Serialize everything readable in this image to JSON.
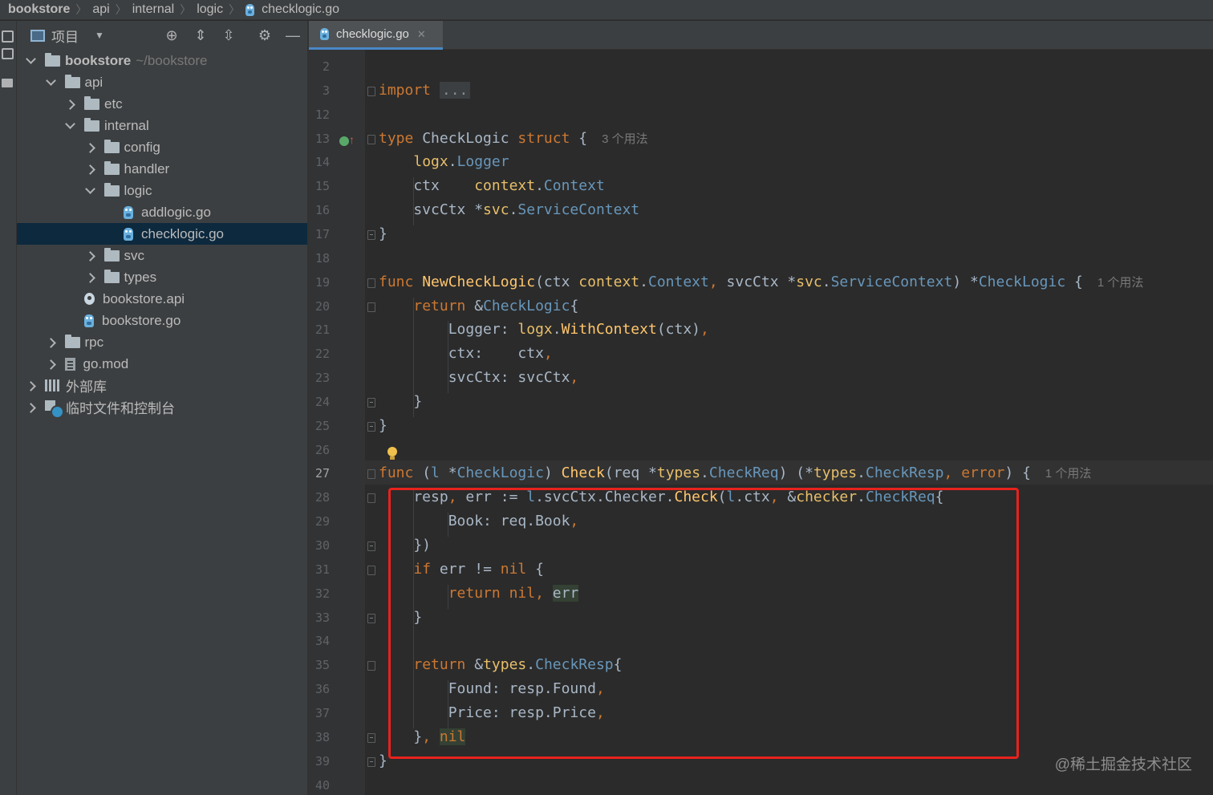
{
  "breadcrumb": [
    "bookstore",
    "api",
    "internal",
    "logic",
    "checklogic.go"
  ],
  "project_panel": {
    "title": "项目",
    "tree": [
      {
        "label": "bookstore",
        "hint": "~/bookstore",
        "depth": 0,
        "chevron": "down",
        "icon": "folder",
        "bold": true
      },
      {
        "label": "api",
        "depth": 1,
        "chevron": "down",
        "icon": "folder"
      },
      {
        "label": "etc",
        "depth": 2,
        "chevron": "right",
        "icon": "folder"
      },
      {
        "label": "internal",
        "depth": 2,
        "chevron": "down",
        "icon": "folder"
      },
      {
        "label": "config",
        "depth": 3,
        "chevron": "right",
        "icon": "folder"
      },
      {
        "label": "handler",
        "depth": 3,
        "chevron": "right",
        "icon": "folder"
      },
      {
        "label": "logic",
        "depth": 3,
        "chevron": "down",
        "icon": "folder"
      },
      {
        "label": "addlogic.go",
        "depth": 4,
        "chevron": "none",
        "icon": "gofile"
      },
      {
        "label": "checklogic.go",
        "depth": 4,
        "chevron": "none",
        "icon": "gofile",
        "selected": true
      },
      {
        "label": "svc",
        "depth": 3,
        "chevron": "right",
        "icon": "folder"
      },
      {
        "label": "types",
        "depth": 3,
        "chevron": "right",
        "icon": "folder"
      },
      {
        "label": "bookstore.api",
        "depth": 2,
        "chevron": "none",
        "icon": "api"
      },
      {
        "label": "bookstore.go",
        "depth": 2,
        "chevron": "none",
        "icon": "gofile"
      },
      {
        "label": "rpc",
        "depth": 1,
        "chevron": "right",
        "icon": "folder"
      },
      {
        "label": "go.mod",
        "depth": 1,
        "chevron": "right",
        "icon": "mod"
      },
      {
        "label": "外部库",
        "depth": 0,
        "chevron": "right",
        "icon": "lib"
      },
      {
        "label": "临时文件和控制台",
        "depth": 0,
        "chevron": "right",
        "icon": "scratch"
      }
    ]
  },
  "editor": {
    "tab_label": "checklogic.go",
    "current_line": "27",
    "lines": [
      {
        "n": "2",
        "tokens": []
      },
      {
        "n": "3",
        "fold": "open",
        "tokens": [
          {
            "t": "kw",
            "v": "import"
          },
          {
            "t": "id",
            "v": " "
          },
          {
            "t": "folded",
            "v": "..."
          }
        ]
      },
      {
        "n": "12",
        "tokens": []
      },
      {
        "n": "13",
        "fold": "open",
        "tokens": [
          {
            "t": "kw",
            "v": "type"
          },
          {
            "t": "id",
            "v": " CheckLogic "
          },
          {
            "t": "kw",
            "v": "struct"
          },
          {
            "t": "id",
            "v": " {"
          },
          {
            "t": "hint",
            "v": "3 个用法"
          }
        ]
      },
      {
        "n": "14",
        "tokens": [
          {
            "t": "id",
            "v": "    "
          },
          {
            "t": "pkg",
            "v": "logx"
          },
          {
            "t": "id",
            "v": "."
          },
          {
            "t": "ty",
            "v": "Logger"
          }
        ]
      },
      {
        "n": "15",
        "tokens": [
          {
            "t": "id",
            "v": "    ctx    "
          },
          {
            "t": "pkg",
            "v": "context"
          },
          {
            "t": "id",
            "v": "."
          },
          {
            "t": "ty",
            "v": "Context"
          }
        ]
      },
      {
        "n": "16",
        "tokens": [
          {
            "t": "id",
            "v": "    svcCtx *"
          },
          {
            "t": "pkg",
            "v": "svc"
          },
          {
            "t": "id",
            "v": "."
          },
          {
            "t": "ty",
            "v": "ServiceContext"
          }
        ]
      },
      {
        "n": "17",
        "fold": "close",
        "tokens": [
          {
            "t": "id",
            "v": "}"
          }
        ]
      },
      {
        "n": "18",
        "tokens": []
      },
      {
        "n": "19",
        "fold": "open",
        "tokens": [
          {
            "t": "kw",
            "v": "func"
          },
          {
            "t": "id",
            "v": " "
          },
          {
            "t": "fn",
            "v": "NewCheckLogic"
          },
          {
            "t": "id",
            "v": "(ctx "
          },
          {
            "t": "pkg",
            "v": "context"
          },
          {
            "t": "id",
            "v": "."
          },
          {
            "t": "ty",
            "v": "Context"
          },
          {
            "t": "kw",
            "v": ","
          },
          {
            "t": "id",
            "v": " svcCtx *"
          },
          {
            "t": "pkg",
            "v": "svc"
          },
          {
            "t": "id",
            "v": "."
          },
          {
            "t": "ty",
            "v": "ServiceContext"
          },
          {
            "t": "id",
            "v": ") *"
          },
          {
            "t": "ty",
            "v": "CheckLogic"
          },
          {
            "t": "id",
            "v": " {"
          },
          {
            "t": "hint",
            "v": "1 个用法"
          }
        ]
      },
      {
        "n": "20",
        "fold": "open",
        "tokens": [
          {
            "t": "id",
            "v": "    "
          },
          {
            "t": "kw",
            "v": "return"
          },
          {
            "t": "id",
            "v": " &"
          },
          {
            "t": "ty",
            "v": "CheckLogic"
          },
          {
            "t": "id",
            "v": "{"
          }
        ]
      },
      {
        "n": "21",
        "tokens": [
          {
            "t": "id",
            "v": "        Logger: "
          },
          {
            "t": "pkg",
            "v": "logx"
          },
          {
            "t": "id",
            "v": "."
          },
          {
            "t": "fn",
            "v": "WithContext"
          },
          {
            "t": "id",
            "v": "(ctx)"
          },
          {
            "t": "kw",
            "v": ","
          }
        ]
      },
      {
        "n": "22",
        "tokens": [
          {
            "t": "id",
            "v": "        ctx:    ctx"
          },
          {
            "t": "kw",
            "v": ","
          }
        ]
      },
      {
        "n": "23",
        "tokens": [
          {
            "t": "id",
            "v": "        svcCtx: svcCtx"
          },
          {
            "t": "kw",
            "v": ","
          }
        ]
      },
      {
        "n": "24",
        "fold": "close",
        "tokens": [
          {
            "t": "id",
            "v": "    }"
          }
        ]
      },
      {
        "n": "25",
        "fold": "close",
        "tokens": [
          {
            "t": "id",
            "v": "}"
          }
        ]
      },
      {
        "n": "26",
        "tokens": []
      },
      {
        "n": "27",
        "fold": "open",
        "tokens": [
          {
            "t": "kw",
            "v": "func"
          },
          {
            "t": "id",
            "v": " ("
          },
          {
            "t": "ty",
            "v": "l"
          },
          {
            "t": "id",
            "v": " *"
          },
          {
            "t": "ty",
            "v": "CheckLogic"
          },
          {
            "t": "id",
            "v": ") "
          },
          {
            "t": "fn",
            "v": "Check"
          },
          {
            "t": "id",
            "v": "(req *"
          },
          {
            "t": "pkg",
            "v": "types"
          },
          {
            "t": "id",
            "v": "."
          },
          {
            "t": "ty",
            "v": "CheckReq"
          },
          {
            "t": "id",
            "v": ") (*"
          },
          {
            "t": "pkg",
            "v": "types"
          },
          {
            "t": "id",
            "v": "."
          },
          {
            "t": "ty",
            "v": "CheckResp"
          },
          {
            "t": "kw",
            "v": ", error"
          },
          {
            "t": "id",
            "v": ") {"
          },
          {
            "t": "hint",
            "v": "1 个用法"
          }
        ]
      },
      {
        "n": "28",
        "fold": "open",
        "tokens": [
          {
            "t": "id",
            "v": "    resp"
          },
          {
            "t": "kw",
            "v": ","
          },
          {
            "t": "id",
            "v": " err := "
          },
          {
            "t": "ty",
            "v": "l"
          },
          {
            "t": "id",
            "v": ".svcCtx.Checker."
          },
          {
            "t": "fn",
            "v": "Check"
          },
          {
            "t": "id",
            "v": "("
          },
          {
            "t": "ty",
            "v": "l"
          },
          {
            "t": "id",
            "v": ".ctx"
          },
          {
            "t": "kw",
            "v": ","
          },
          {
            "t": "id",
            "v": " &"
          },
          {
            "t": "pkg",
            "v": "checker"
          },
          {
            "t": "id",
            "v": "."
          },
          {
            "t": "ty",
            "v": "CheckReq"
          },
          {
            "t": "id",
            "v": "{"
          }
        ]
      },
      {
        "n": "29",
        "tokens": [
          {
            "t": "id",
            "v": "        Book: req.Book"
          },
          {
            "t": "kw",
            "v": ","
          }
        ]
      },
      {
        "n": "30",
        "fold": "close",
        "tokens": [
          {
            "t": "id",
            "v": "    })"
          }
        ]
      },
      {
        "n": "31",
        "fold": "open",
        "tokens": [
          {
            "t": "id",
            "v": "    "
          },
          {
            "t": "kw",
            "v": "if"
          },
          {
            "t": "id",
            "v": " err != "
          },
          {
            "t": "kw",
            "v": "nil"
          },
          {
            "t": "id",
            "v": " {"
          }
        ]
      },
      {
        "n": "32",
        "tokens": [
          {
            "t": "id",
            "v": "        "
          },
          {
            "t": "kw",
            "v": "return"
          },
          {
            "t": "id",
            "v": " "
          },
          {
            "t": "kw",
            "v": "nil"
          },
          {
            "t": "kw",
            "v": ","
          },
          {
            "t": "id",
            "v": " "
          },
          {
            "t": "hl",
            "v": "err"
          }
        ]
      },
      {
        "n": "33",
        "fold": "close",
        "tokens": [
          {
            "t": "id",
            "v": "    }"
          }
        ]
      },
      {
        "n": "34",
        "tokens": []
      },
      {
        "n": "35",
        "fold": "open",
        "tokens": [
          {
            "t": "id",
            "v": "    "
          },
          {
            "t": "kw",
            "v": "return"
          },
          {
            "t": "id",
            "v": " &"
          },
          {
            "t": "pkg",
            "v": "types"
          },
          {
            "t": "id",
            "v": "."
          },
          {
            "t": "ty",
            "v": "CheckResp"
          },
          {
            "t": "id",
            "v": "{"
          }
        ]
      },
      {
        "n": "36",
        "tokens": [
          {
            "t": "id",
            "v": "        Found: resp.Found"
          },
          {
            "t": "kw",
            "v": ","
          }
        ]
      },
      {
        "n": "37",
        "tokens": [
          {
            "t": "id",
            "v": "        Price: resp.Price"
          },
          {
            "t": "kw",
            "v": ","
          }
        ]
      },
      {
        "n": "38",
        "fold": "close",
        "tokens": [
          {
            "t": "id",
            "v": "    }"
          },
          {
            "t": "kw",
            "v": ","
          },
          {
            "t": "id",
            "v": " "
          },
          {
            "t": "hlkw",
            "v": "nil"
          }
        ]
      },
      {
        "n": "39",
        "fold": "close",
        "tokens": [
          {
            "t": "id",
            "v": "}"
          }
        ]
      },
      {
        "n": "40",
        "tokens": []
      }
    ]
  },
  "watermark": "@稀土掘金技术社区",
  "colors": {
    "keyword": "#cc7832",
    "function": "#ffc66d",
    "type": "#6897bb",
    "package": "#e8bf6a",
    "highlight_box": "#e8221d"
  }
}
